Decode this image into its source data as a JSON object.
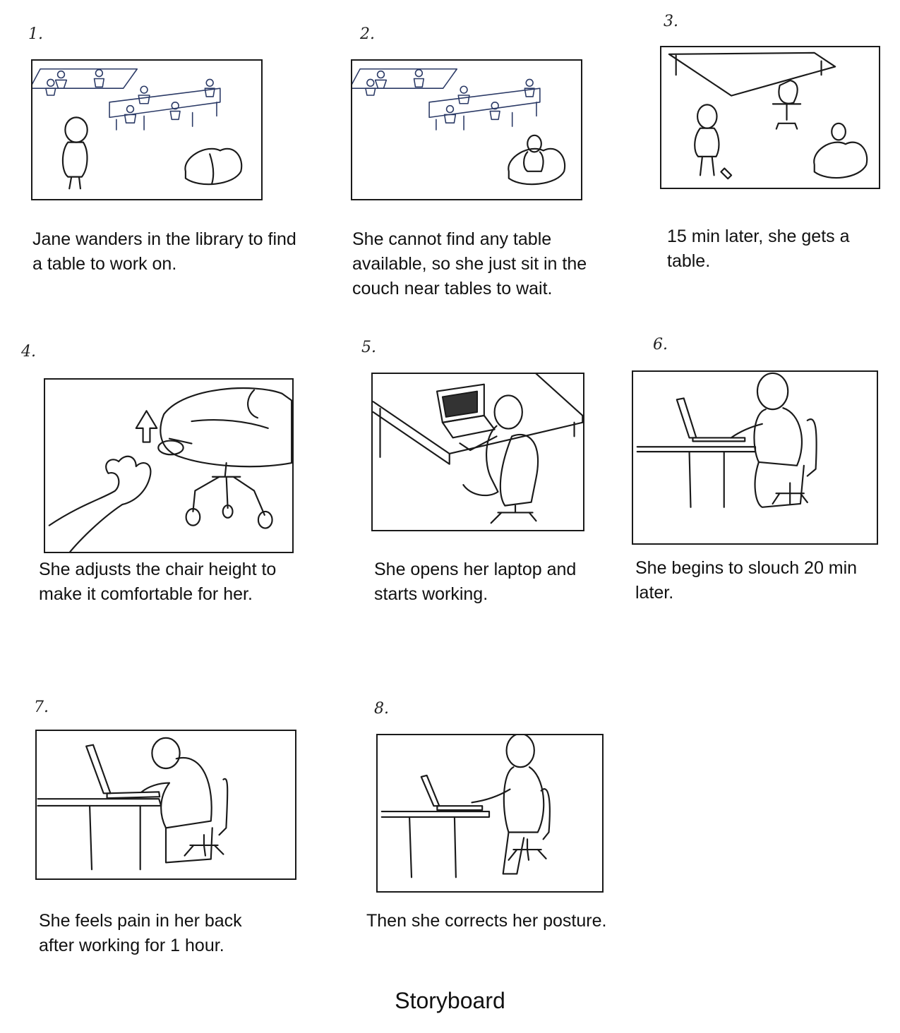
{
  "title": "Storyboard",
  "panels": [
    {
      "number": "1.",
      "caption": "Jane wanders in the library to find a table to work on.",
      "scene": "library-tables"
    },
    {
      "number": "2.",
      "caption": "She cannot find any table available, so she just sit in the couch near tables to wait.",
      "scene": "library-couch"
    },
    {
      "number": "3.",
      "caption": "15 min later, she gets a table.",
      "scene": "gets-table"
    },
    {
      "number": "4.",
      "caption": "She adjusts the chair height to make it comfortable for her.",
      "scene": "adjust-chair"
    },
    {
      "number": "5.",
      "caption": "She opens her laptop and starts working.",
      "scene": "open-laptop"
    },
    {
      "number": "6.",
      "caption": "She begins to slouch 20 min later.",
      "scene": "slouch"
    },
    {
      "number": "7.",
      "caption": "She feels pain in her back after working for 1 hour.",
      "scene": "back-pain"
    },
    {
      "number": "8.",
      "caption": "Then she corrects her posture.",
      "scene": "correct-posture"
    }
  ]
}
